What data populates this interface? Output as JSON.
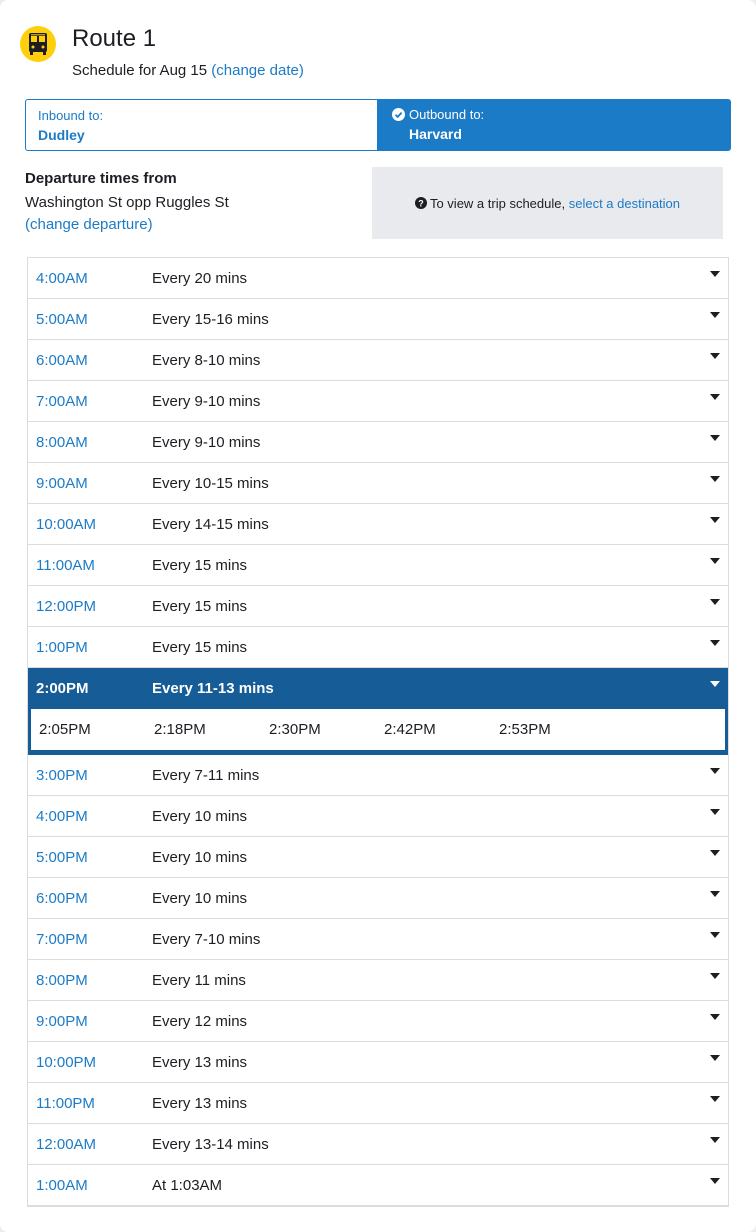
{
  "header": {
    "title": "Route 1",
    "schedule_prefix": "Schedule for Aug 15",
    "change_date": "(change date)",
    "icon": "bus-icon",
    "icon_color": "#ffce0c"
  },
  "direction": {
    "inbound_label": "Inbound to:",
    "inbound_dest": "Dudley",
    "outbound_label": "Outbound to:",
    "outbound_dest": "Harvard",
    "selected": "outbound",
    "accent": "#1c7bc6"
  },
  "departure": {
    "heading": "Departure times from",
    "stop": "Washington St opp Ruggles St",
    "change": "(change departure)"
  },
  "info": {
    "text": "To view a trip schedule,",
    "link": "select a destination"
  },
  "schedule": [
    {
      "time": "4:00AM",
      "freq": "Every 20 mins"
    },
    {
      "time": "5:00AM",
      "freq": "Every 15-16 mins"
    },
    {
      "time": "6:00AM",
      "freq": "Every 8-10 mins"
    },
    {
      "time": "7:00AM",
      "freq": "Every 9-10 mins"
    },
    {
      "time": "8:00AM",
      "freq": "Every 9-10 mins"
    },
    {
      "time": "9:00AM",
      "freq": "Every 10-15 mins"
    },
    {
      "time": "10:00AM",
      "freq": "Every 14-15 mins"
    },
    {
      "time": "11:00AM",
      "freq": "Every 15 mins"
    },
    {
      "time": "12:00PM",
      "freq": "Every 15 mins"
    },
    {
      "time": "1:00PM",
      "freq": "Every 15 mins"
    },
    {
      "time": "2:00PM",
      "freq": "Every 11-13 mins"
    },
    {
      "time": "3:00PM",
      "freq": "Every 7-11 mins"
    },
    {
      "time": "4:00PM",
      "freq": "Every 10 mins"
    },
    {
      "time": "5:00PM",
      "freq": "Every 10 mins"
    },
    {
      "time": "6:00PM",
      "freq": "Every 10 mins"
    },
    {
      "time": "7:00PM",
      "freq": "Every 7-10 mins"
    },
    {
      "time": "8:00PM",
      "freq": "Every 11 mins"
    },
    {
      "time": "9:00PM",
      "freq": "Every 12 mins"
    },
    {
      "time": "10:00PM",
      "freq": "Every 13 mins"
    },
    {
      "time": "11:00PM",
      "freq": "Every 13 mins"
    },
    {
      "time": "12:00AM",
      "freq": "Every 13-14 mins"
    },
    {
      "time": "1:00AM",
      "freq": "At 1:03AM"
    }
  ],
  "expanded_times": [
    "2:05PM",
    "2:18PM",
    "2:30PM",
    "2:42PM",
    "2:53PM"
  ],
  "colors": {
    "selected_row": "#165c96",
    "link": "#1c7bc6",
    "info_bg": "#e9eaed"
  }
}
